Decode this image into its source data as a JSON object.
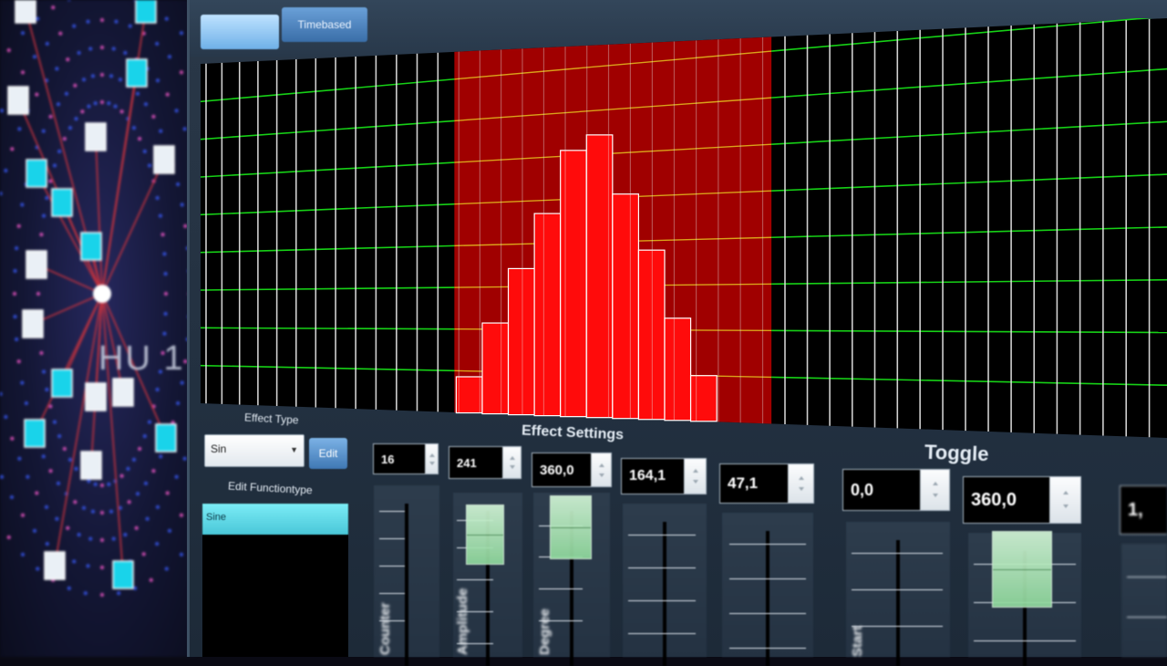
{
  "background": {
    "hub_label": "HU 1",
    "colors": {
      "node_cyan": "#19d3ea",
      "link_red": "#c4323e",
      "panel_blue": "#1d2050"
    }
  },
  "tabs": [
    {
      "label": "",
      "active": true
    },
    {
      "label": "Timebased",
      "active": false
    }
  ],
  "graph": {
    "colors": {
      "background": "#000000",
      "grid_vertical": "#e6e6e6",
      "grid_horizontal": "#16d016",
      "grid_horizontal_on_red": "#d9a21a",
      "effect_band": "#a00000",
      "bar_fill": "#ff0b0b",
      "bar_outline": "#ffffff"
    },
    "grid_columns": 45,
    "effect_band_columns": [
      14,
      26
    ],
    "bar_levels": [
      0.1,
      0.25,
      0.4,
      0.55,
      0.72,
      0.76,
      0.6,
      0.45,
      0.27,
      0.12
    ]
  },
  "left_panel": {
    "effect_type_label": "Effect Type",
    "effect_type_value": "Sin",
    "edit_button_label": "Edit",
    "edit_function_label": "Edit Functiontype",
    "function_selected": "Sine"
  },
  "effect_settings": {
    "title": "Effect Settings",
    "controls": [
      {
        "value": "16",
        "label": "Counter",
        "thumb_level": null
      },
      {
        "value": "241",
        "label": "Amplitude",
        "thumb_level": 0.72
      },
      {
        "value": "360,0",
        "label": "Degree",
        "thumb_level": 0.85
      },
      {
        "value": "164,1",
        "label": "",
        "thumb_level": null
      },
      {
        "value": "47,1",
        "label": "",
        "thumb_level": null
      }
    ]
  },
  "toggle": {
    "title": "Toggle",
    "controls": [
      {
        "value": "0,0",
        "label": "Start",
        "thumb_level": null
      },
      {
        "value": "360,0",
        "label": "",
        "thumb_level": 0.55
      },
      {
        "value": "1,",
        "label": "",
        "thumb_level": null
      }
    ]
  }
}
